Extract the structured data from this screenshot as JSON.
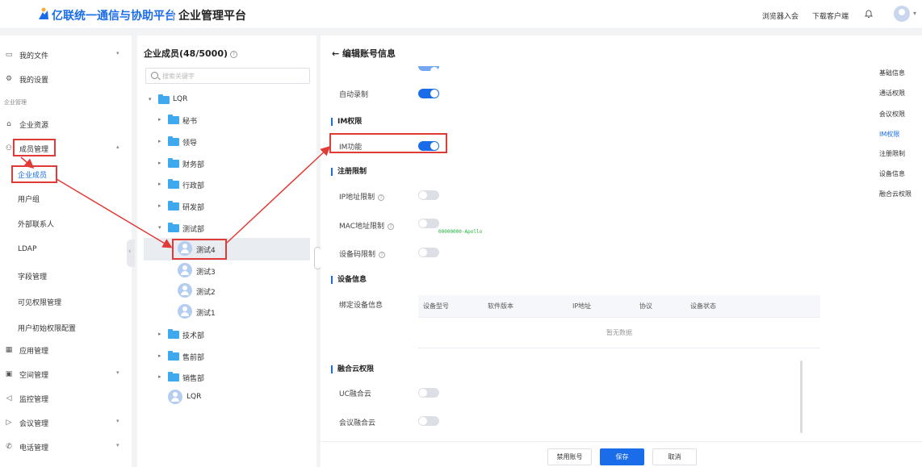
{
  "header": {
    "brand": "亿联统一通信与协助平台",
    "platform": "企业管理平台",
    "browser_entry": "浏览器入会",
    "download_client": "下载客户端"
  },
  "sidebar": {
    "my_files": "我的文件",
    "my_settings": "我的设置",
    "enterprise_group": "企业管理",
    "enterprise_resources": "企业资源",
    "member_mgmt": "成员管理",
    "enterprise_members": "企业成员",
    "user_groups": "用户组",
    "external_contacts": "外部联系人",
    "ldap": "LDAP",
    "field_mgmt": "字段管理",
    "visibility_mgmt": "可见权限管理",
    "user_initial_perm": "用户初始权限配置",
    "app_mgmt": "应用管理",
    "space_mgmt": "空间管理",
    "monitor_mgmt": "监控管理",
    "meeting_mgmt": "会议管理",
    "phone_mgmt": "电话管理"
  },
  "tree": {
    "title": "企业成员(48/5000)",
    "search_placeholder": "搜索关键字",
    "root": "LQR",
    "secretary": "秘书",
    "leader": "领导",
    "finance": "财务部",
    "admin": "行政部",
    "rnd": "研发部",
    "test_dept": "测试部",
    "test4": "测试4",
    "test3": "测试3",
    "test2": "测试2",
    "test1": "测试1",
    "tech": "技术部",
    "presales": "售前部",
    "sales": "销售部",
    "lqr_user": "LQR"
  },
  "main": {
    "title": "编辑账号信息",
    "auto_record": "自动录制",
    "im_section": "IM权限",
    "im_func": "IM功能",
    "reg_section": "注册限制",
    "ip_limit": "IP地址限制",
    "mac_limit": "MAC地址限制",
    "device_code_limit": "设备码限制",
    "device_section": "设备信息",
    "bind_device": "绑定设备信息",
    "device_cols": [
      "设备型号",
      "软件版本",
      "IP地址",
      "协议",
      "设备状态"
    ],
    "no_data": "暂无数据",
    "cloud_section": "融合云权限",
    "uc_cloud": "UC融合云",
    "meeting_cloud": "会议融合云",
    "watermark": "00000000-Apollo",
    "toggles": {
      "auto_record": true,
      "im_func": true,
      "ip_limit": false,
      "mac_limit": false,
      "device_code_limit": false,
      "uc_cloud": false,
      "meeting_cloud": false
    }
  },
  "footer": {
    "disable": "禁用账号",
    "save": "保存",
    "cancel": "取消"
  },
  "right_nav": {
    "basic": "基础信息",
    "call_perm": "通话权限",
    "meeting_perm": "会议权限",
    "im_perm": "IM权限",
    "reg_limit": "注册限制",
    "device_info": "设备信息",
    "cloud_perm": "融合云权限"
  },
  "colors": {
    "accent": "#1a6ce8",
    "annotation": "#e23a36",
    "folder": "#3ea9ef"
  }
}
